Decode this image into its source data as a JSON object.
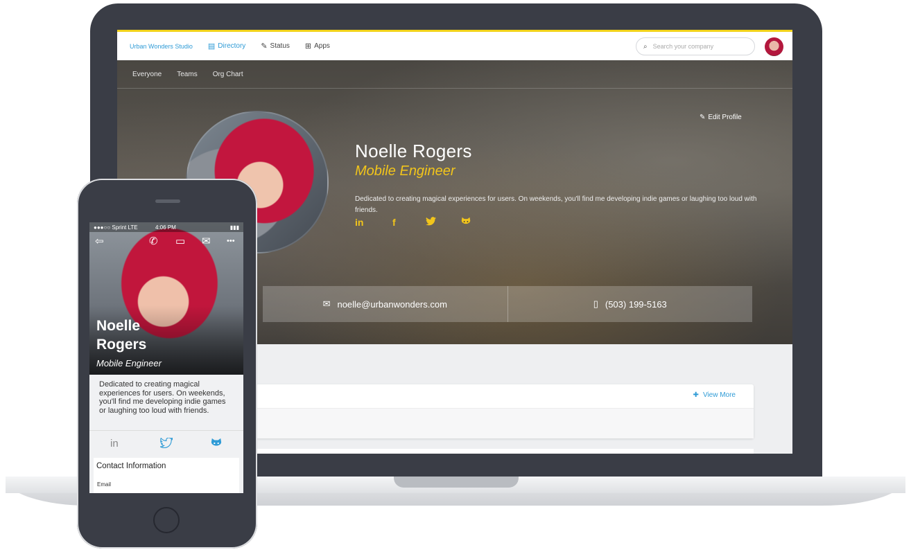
{
  "desktop": {
    "nav": {
      "brand": "Urban Wonders Studio",
      "items": [
        {
          "label": "Directory",
          "icon": "directory-icon",
          "active": true
        },
        {
          "label": "Status",
          "icon": "status-icon",
          "active": false
        },
        {
          "label": "Apps",
          "icon": "apps-icon",
          "active": false
        }
      ],
      "search_placeholder": "Search your company"
    },
    "subnav": [
      "Everyone",
      "Teams",
      "Org Chart"
    ],
    "profile": {
      "name": "Noelle Rogers",
      "title": "Mobile Engineer",
      "bio": "Dedicated to creating magical experiences for users. On weekends, you'll find me developing indie games or laughing too loud with friends.",
      "edit_label": "Edit Profile",
      "social": [
        "in",
        "f"
      ],
      "email": "noelle@urbanwonders.com",
      "phone": "(503) 199-5163"
    },
    "card": {
      "view_more": "View More"
    }
  },
  "mobile": {
    "status": {
      "carrier": "●●●○○ Sprint  LTE",
      "time": "4:06 PM",
      "battery": "▮▮▮"
    },
    "name": "Noelle Rogers",
    "title": "Mobile Engineer",
    "bio": "Dedicated to creating magical experiences for users. On weekends, you'll find me developing indie games or laughing too loud with friends.",
    "social_linkedin": "in",
    "contact_title": "Contact Information",
    "contact_sub": "Email"
  },
  "colors": {
    "accent": "#f2c51b",
    "link": "#2f9bd6",
    "device": "#3a3d46"
  }
}
